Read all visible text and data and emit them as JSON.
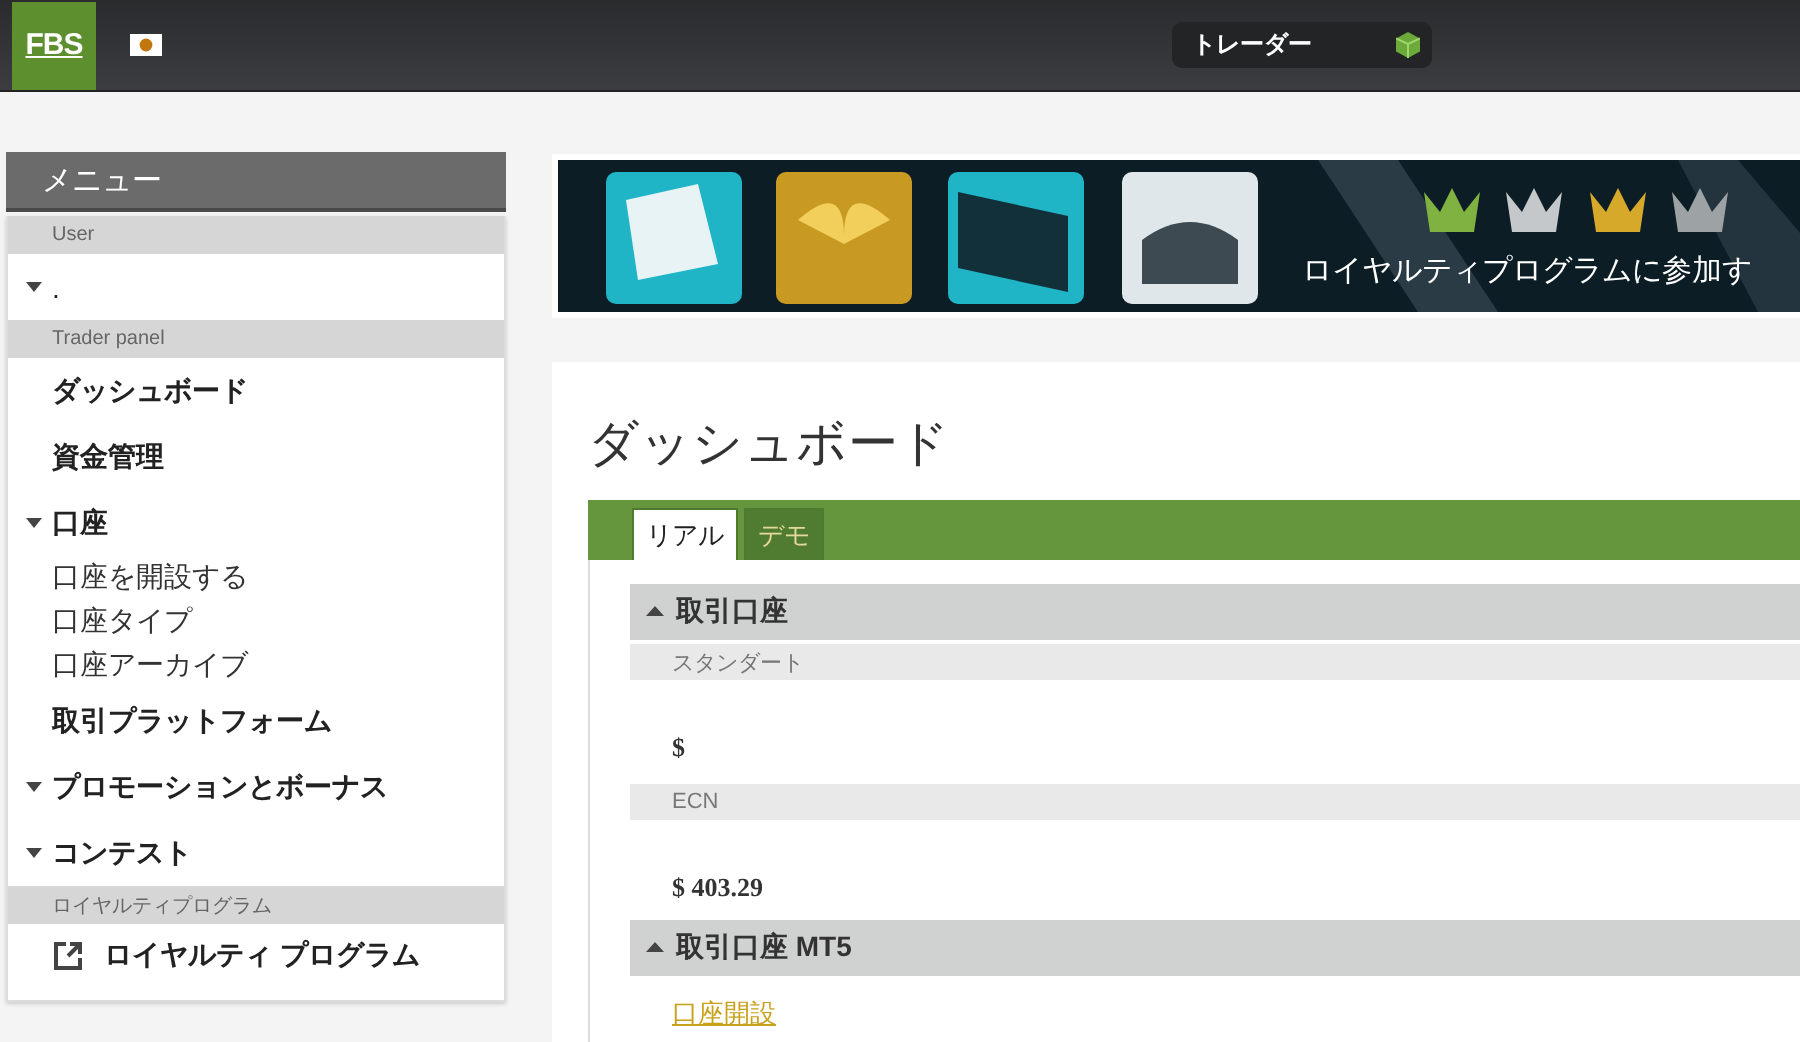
{
  "topbar": {
    "logo": "FBS",
    "user": {
      "role": "トレーダー"
    }
  },
  "sidebar": {
    "title": "メニュー",
    "items": [
      {
        "kind": "section",
        "label": "User"
      },
      {
        "kind": "group",
        "label": ".",
        "bold": false
      },
      {
        "kind": "section",
        "label": "Trader panel"
      },
      {
        "kind": "item",
        "label": "ダッシュボード"
      },
      {
        "kind": "item",
        "label": "資金管理"
      },
      {
        "kind": "group",
        "label": "口座",
        "bold": true,
        "children": [
          {
            "label": "口座を開設する"
          },
          {
            "label": "口座タイプ"
          },
          {
            "label": "口座アーカイブ"
          }
        ]
      },
      {
        "kind": "item",
        "label": "取引プラットフォーム"
      },
      {
        "kind": "group",
        "label": "プロモーションとボーナス",
        "bold": true
      },
      {
        "kind": "group",
        "label": "コンテスト",
        "bold": true
      },
      {
        "kind": "section",
        "label": "ロイヤルティプログラム"
      },
      {
        "kind": "external",
        "label": "ロイヤルティ プログラム"
      }
    ]
  },
  "banner": {
    "kind": "picture",
    "caption": "ロイヤルティプログラムに参加す"
  },
  "dashboard": {
    "title": "ダッシュボード",
    "tabs": [
      {
        "label": "リアル",
        "selected": true
      },
      {
        "label": "デモ",
        "selected": false
      }
    ],
    "sections": [
      {
        "title": "取引口座",
        "accounts": [
          {
            "type": "スタンダート",
            "balance": "$"
          },
          {
            "type": "ECN",
            "balance": "$ 403.29"
          }
        ]
      },
      {
        "title": "取引口座 MT5",
        "link": "口座開設"
      }
    ]
  }
}
